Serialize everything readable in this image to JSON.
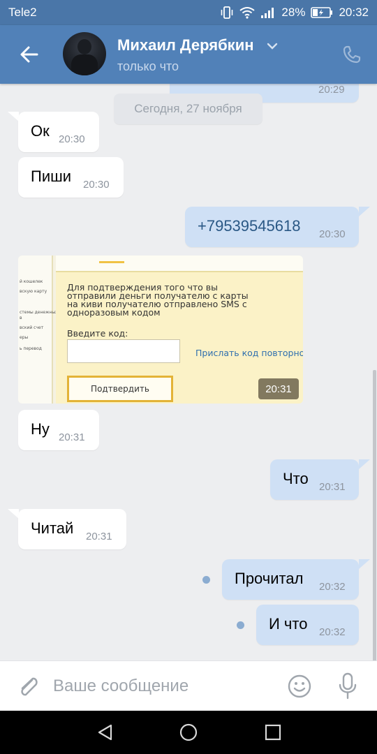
{
  "status_bar": {
    "carrier": "Tele2",
    "battery_percent": "28%",
    "time": "20:32"
  },
  "header": {
    "contact_name": "Михаил Дерябкин",
    "contact_status": "только что"
  },
  "chat": {
    "prev_time": "20:29",
    "date_chip": "Сегодня, 27 ноября",
    "messages": [
      {
        "text": "Ок",
        "time": "20:30"
      },
      {
        "text": "Пиши",
        "time": "20:30"
      },
      {
        "text": "+79539545618",
        "time": "20:30"
      },
      {
        "text": "Ну",
        "time": "20:31"
      },
      {
        "text": "Что",
        "time": "20:31"
      },
      {
        "text": "Читай",
        "time": "20:31"
      },
      {
        "text": "Прочитал",
        "time": "20:32"
      },
      {
        "text": "И что",
        "time": "20:32"
      }
    ],
    "photo": {
      "time": "20:31",
      "sidebar_lines": [
        "й кошелек",
        "вскую карту",
        "стемы денежных",
        "в",
        "вский счет",
        "еры",
        "ь перевод"
      ],
      "text": "Для подтверждения того что вы отправили деньги получателю с карты на киви получателю отправлено SMS с одноразовым кодом",
      "code_label": "Введите код:",
      "resend_link": "Прислать код повторно",
      "confirm_button": "Подтвердить"
    }
  },
  "composer": {
    "placeholder": "Ваше сообщение"
  },
  "colors": {
    "header": "#5181b8",
    "status_bar": "#4a76a8",
    "outgoing": "#cfe0f5",
    "incoming": "#ffffff",
    "background": "#edeef0"
  }
}
